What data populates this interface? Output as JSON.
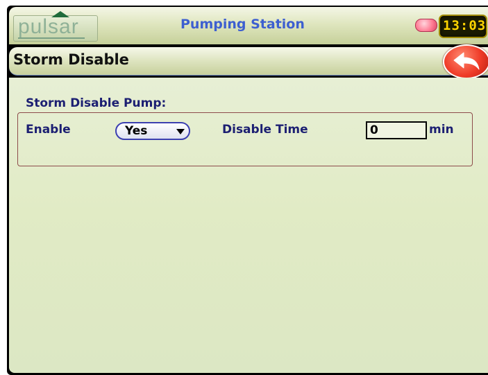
{
  "header": {
    "logo_text": "pulsar",
    "app_title": "Pumping Station",
    "clock": "13:03",
    "status_led_color": "#ff7d95"
  },
  "screen": {
    "title": "Storm Disable",
    "back_icon": "back-arrow-icon"
  },
  "section": {
    "title": "Storm Disable Pump:",
    "enable_label": "Enable",
    "enable_value": "Yes",
    "disable_time_label": "Disable Time",
    "disable_time_value": "0",
    "disable_time_unit": "min"
  },
  "colors": {
    "label": "#1c1f72",
    "title_accent": "#3d5fd0",
    "back_button": "#ef3b28"
  }
}
